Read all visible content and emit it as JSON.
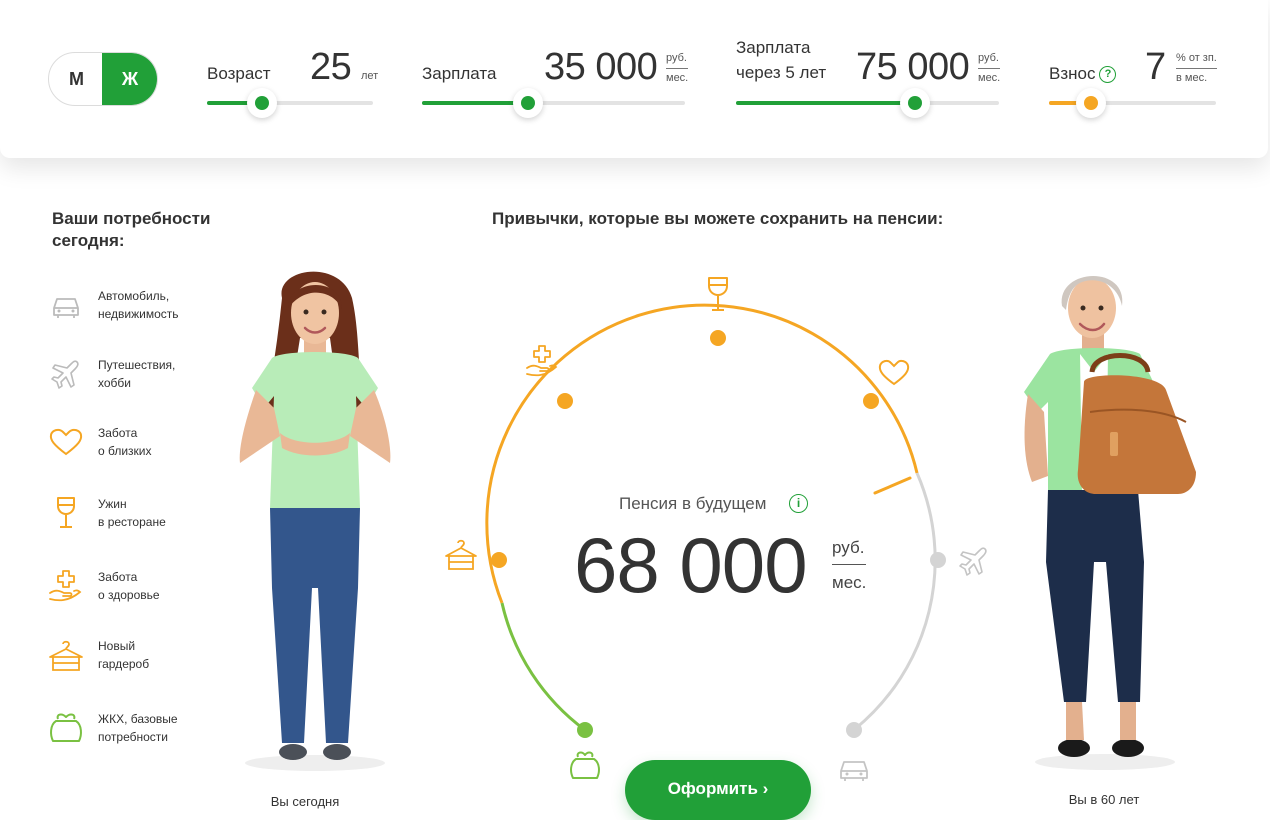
{
  "gender": {
    "male_label": "М",
    "female_label": "Ж",
    "selected": "female"
  },
  "sliders": {
    "age": {
      "label": "Возраст",
      "value": "25",
      "unit": "лет",
      "fill_fraction": 0.33
    },
    "salary": {
      "label": "Зарплата",
      "value": "35 000",
      "unit_top": "руб.",
      "unit_bottom": "мес.",
      "fill_fraction": 0.38
    },
    "salary_future": {
      "label_line1": "Зарплата",
      "label_line2": "через 5 лет",
      "value": "75 000",
      "unit_top": "руб.",
      "unit_bottom": "мес.",
      "fill_fraction": 0.68
    },
    "contribution": {
      "label": "Взнос",
      "value": "7",
      "unit_top": "% от зп.",
      "unit_bottom": "в мес.",
      "fill_fraction": 0.25
    }
  },
  "needs": {
    "title": "Ваши потребности сегодня:",
    "items": [
      {
        "icon": "car-icon",
        "line1": "Автомобиль,",
        "line2": "недвижимость",
        "color": "#bbbbbb"
      },
      {
        "icon": "plane-icon",
        "line1": "Путешествия,",
        "line2": "хобби",
        "color": "#bbbbbb"
      },
      {
        "icon": "heart-icon",
        "line1": "Забота",
        "line2": "о близких",
        "color": "#f5a623"
      },
      {
        "icon": "wine-glass-icon",
        "line1": "Ужин",
        "line2": "в ресторане",
        "color": "#f5a623"
      },
      {
        "icon": "health-icon",
        "line1": "Забота",
        "line2": "о здоровье",
        "color": "#f5a623"
      },
      {
        "icon": "hanger-icon",
        "line1": "Новый",
        "line2": "гардероб",
        "color": "#f5a623"
      },
      {
        "icon": "wallet-icon",
        "line1": "ЖКХ, базовые",
        "line2": "потребности",
        "color": "#7ac142"
      }
    ]
  },
  "habits_title": "Привычки, которые вы можете сохранить на пенсии:",
  "pension": {
    "label": "Пенсия в будущем",
    "info_icon": "i",
    "value": "68 000",
    "unit_top": "руб.",
    "unit_bottom": "мес."
  },
  "people": {
    "today_caption": "Вы сегодня",
    "future_caption": "Вы в 60 лет"
  },
  "submit": {
    "label": "Оформить ›"
  },
  "colors": {
    "green": "#21a038",
    "light_green": "#7ac142",
    "orange": "#f5a623",
    "grey": "#cccccc"
  }
}
